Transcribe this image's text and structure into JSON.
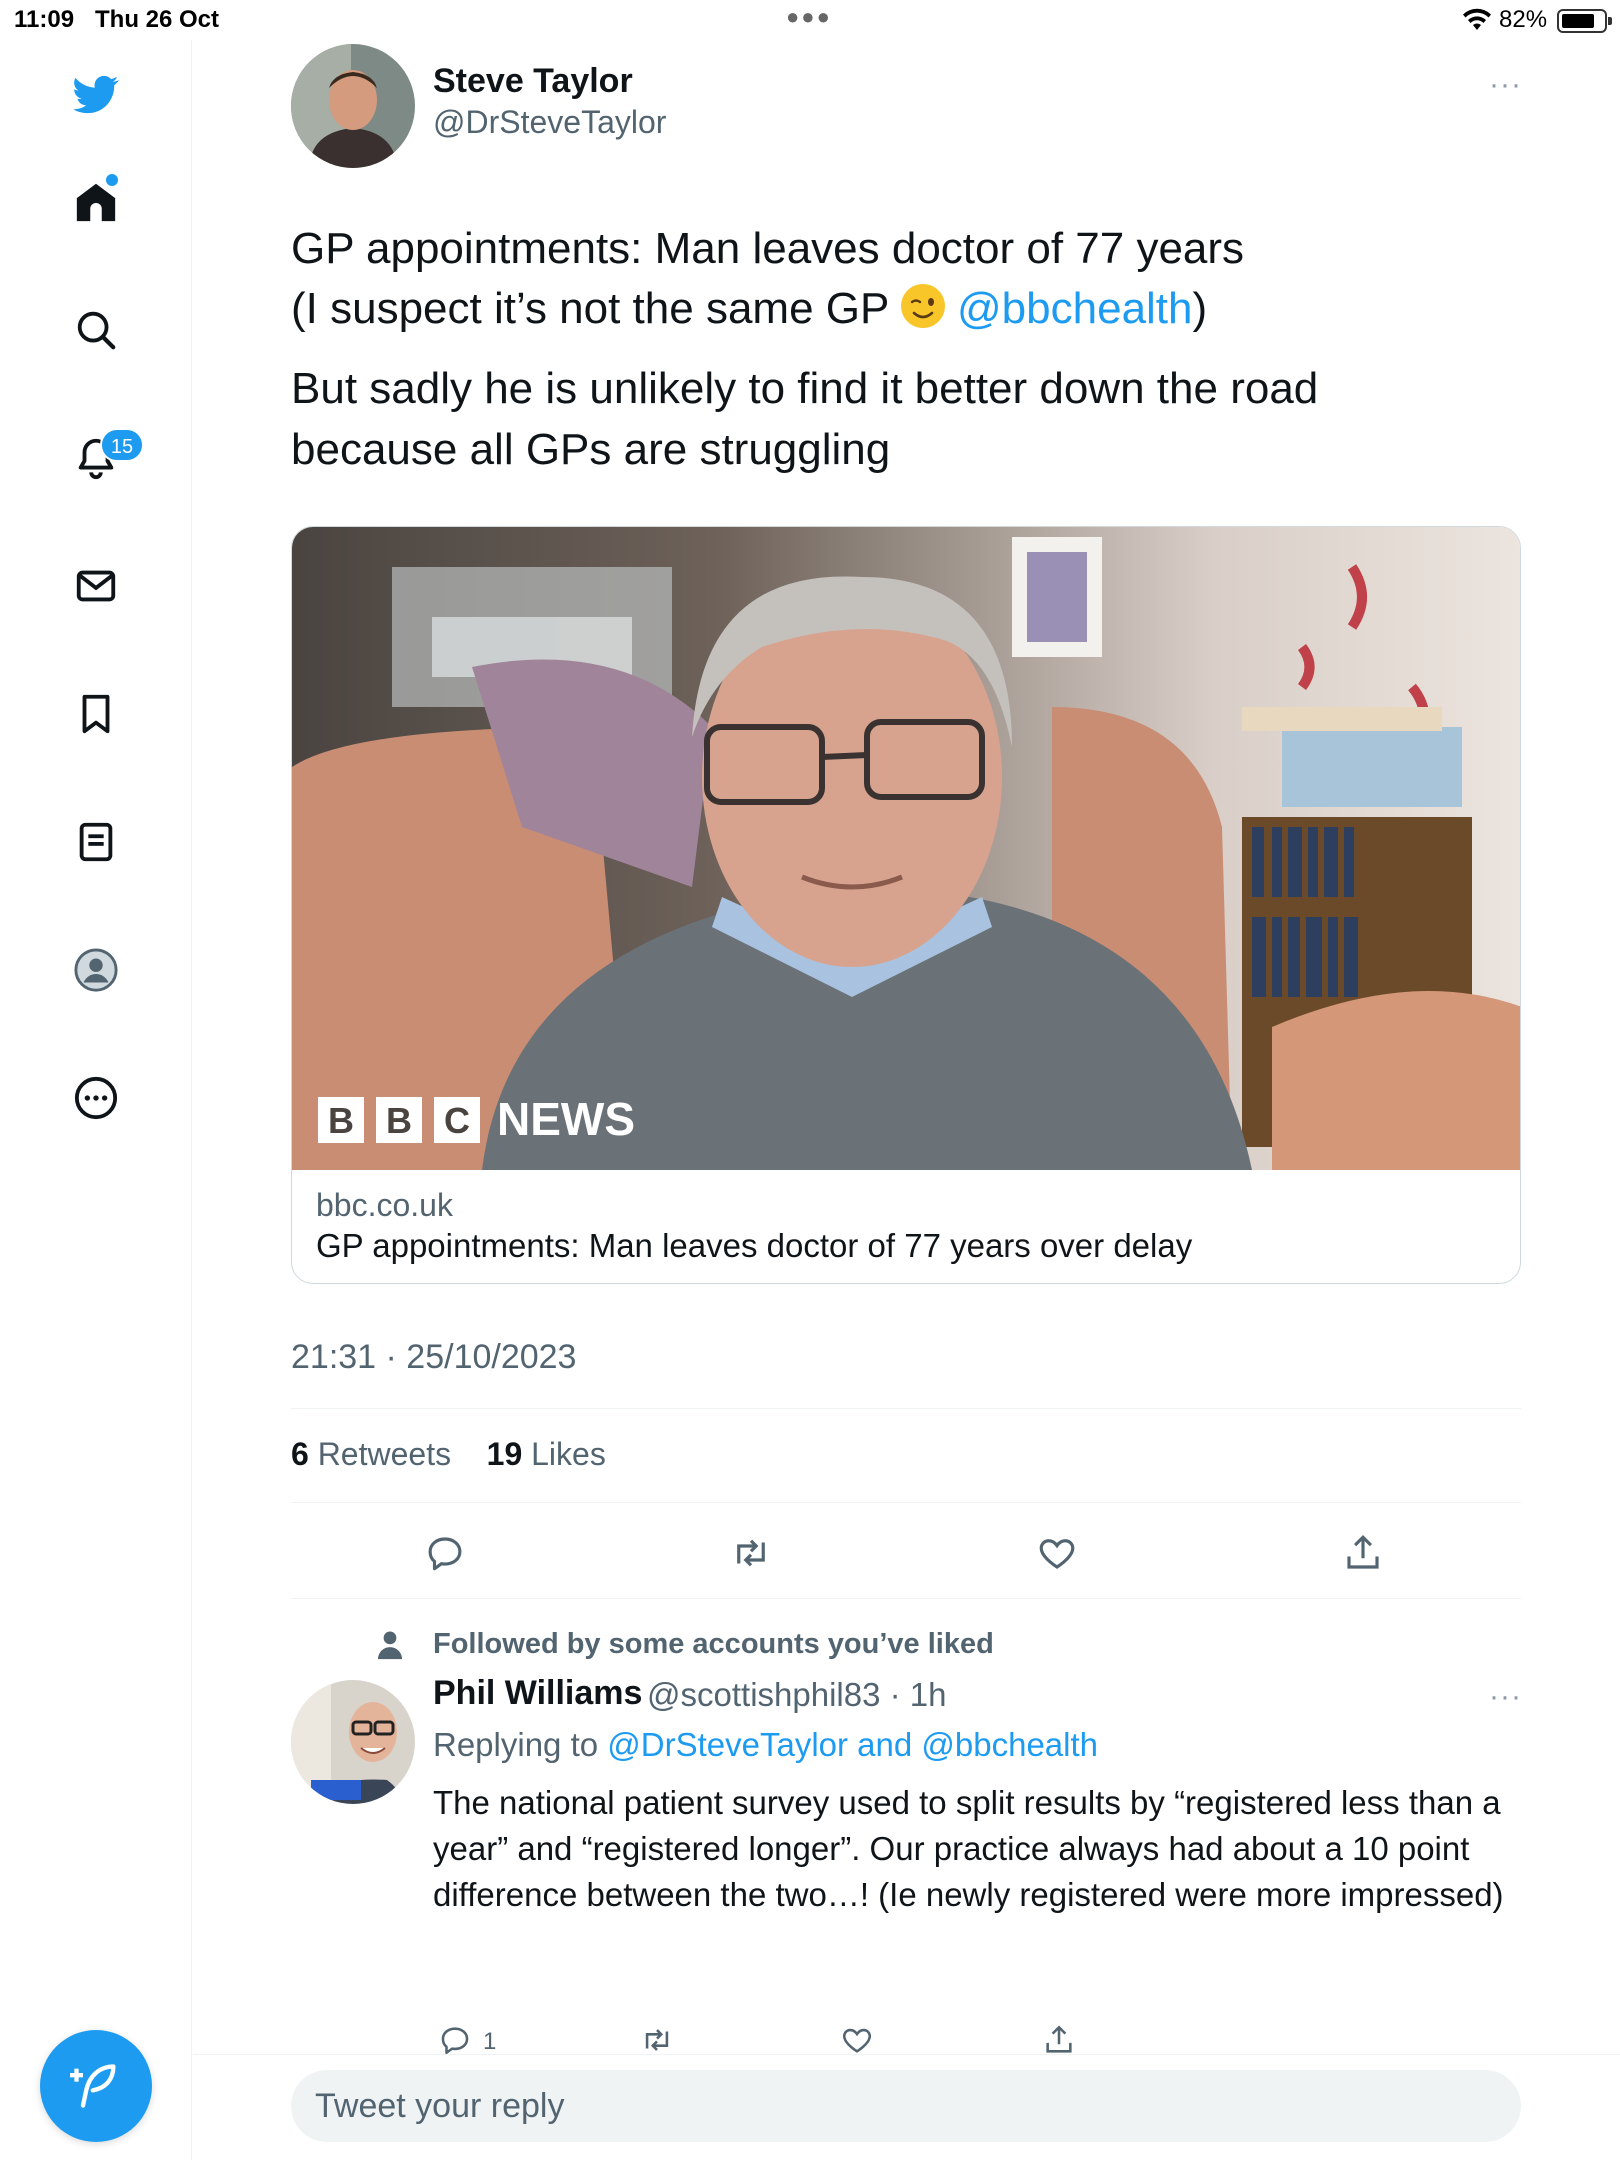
{
  "status_bar": {
    "time": "11:09",
    "date": "Thu 26 Oct",
    "battery": "82%"
  },
  "sidebar": {
    "notifications_badge": "15",
    "items": [
      {
        "icon": "twitter-bird-icon"
      },
      {
        "icon": "home-icon"
      },
      {
        "icon": "search-icon"
      },
      {
        "icon": "bell-icon"
      },
      {
        "icon": "mail-icon"
      },
      {
        "icon": "bookmark-icon"
      },
      {
        "icon": "lists-icon"
      },
      {
        "icon": "profile-icon"
      },
      {
        "icon": "more-circle-icon"
      }
    ],
    "compose_icon": "compose-feather-icon"
  },
  "tweet": {
    "author_name": "Steve Taylor",
    "author_handle": "@DrSteveTaylor",
    "line1": "GP appointments: Man leaves doctor of 77 years",
    "line2_prefix": "(I suspect it’s not the same GP ",
    "line2_mention": "@bbchealth",
    "line2_suffix": ")",
    "line3": "But sadly he is unlikely to find it better down the road",
    "line4": "because all GPs are struggling",
    "card": {
      "logo_letters": [
        "B",
        "B",
        "C"
      ],
      "logo_word": "NEWS",
      "domain": "bbc.co.uk",
      "title": "GP appointments: Man leaves doctor of 77 years over delay"
    },
    "timestamp": "21:31 · 25/10/2023",
    "retweets_count": "6",
    "retweets_label": "Retweets",
    "likes_count": "19",
    "likes_label": "Likes"
  },
  "reply": {
    "context": "Followed by some accounts you’ve liked",
    "author_name": "Phil Williams",
    "author_handle_time": "@scottishphil83 · 1h",
    "replying_prefix": "Replying to ",
    "replying_links": "@DrSteveTaylor and @bbchealth",
    "text": "The national patient survey used to split results by “registered less than a year” and “registered longer”. Our practice always had about a 10 point difference between the two…! (Ie newly registered were more impressed)",
    "reply_count": "1"
  },
  "composer": {
    "placeholder": "Tweet your reply"
  },
  "colors": {
    "accent": "#1d9bf0",
    "secondary_text": "#536471",
    "primary_text": "#0f1419"
  }
}
